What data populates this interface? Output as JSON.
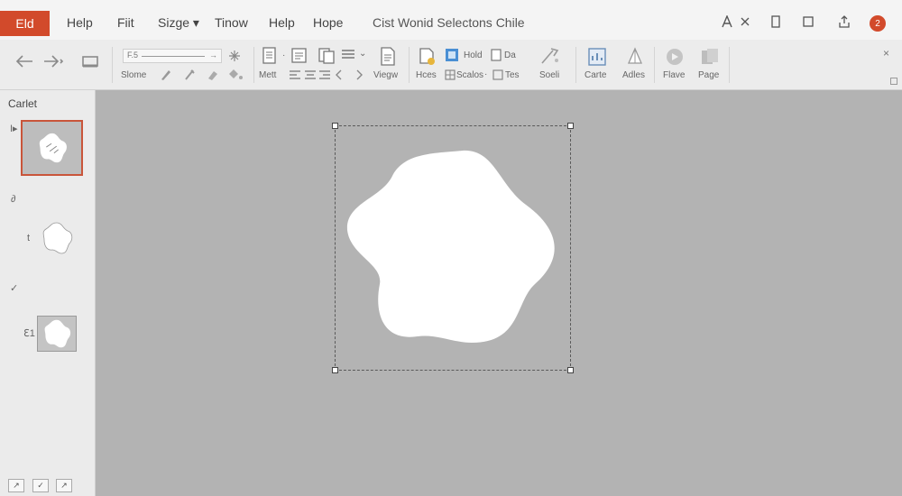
{
  "menubar": {
    "app_badge": "Eld",
    "items": [
      "Help",
      "Fiit",
      "Sizge ▾",
      "Tinow",
      "Help",
      "Hope"
    ],
    "document_title": "Cist Wonid Selectons Chile",
    "notification_count": "2"
  },
  "ribbon": {
    "slider_label": "F.5",
    "slider_arrow": "→",
    "labels": {
      "slome": "Slome",
      "mett": "Mett",
      "viegw": "Viegw",
      "hces": "Hces",
      "hold": "Hold",
      "da": "Da",
      "scalos": "Scalos",
      "tes": "Tes",
      "soeli": "Soeli",
      "carte": "Carte",
      "adles": "Adles",
      "flave": "Flave",
      "page": "Page"
    },
    "close_glyph": "×"
  },
  "left_panel": {
    "title": "Carlet",
    "marks": {
      "cursor": "I▸",
      "mark_2": "∂",
      "mark_3": "t",
      "check": "✓",
      "mark_5": "ℇ1"
    },
    "bottom_buttons": [
      "↗",
      "✓",
      "↗"
    ]
  },
  "colors": {
    "accent": "#d24a2b",
    "canvas": "#b3b3b3",
    "shape_fill": "#ffffff"
  }
}
